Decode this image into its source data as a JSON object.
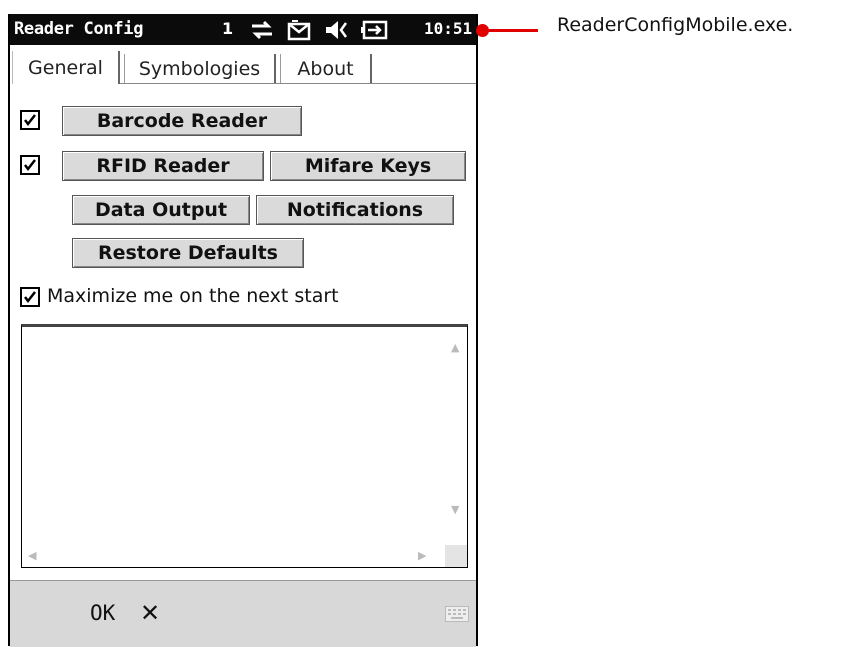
{
  "window": {
    "title": "Reader Config",
    "indicator": "1",
    "time": "10:51"
  },
  "tabs": [
    {
      "label": "General",
      "active": true
    },
    {
      "label": "Symbologies",
      "active": false
    },
    {
      "label": "About",
      "active": false
    }
  ],
  "general": {
    "barcode_checked": true,
    "barcode_button": "Barcode Reader",
    "rfid_checked": true,
    "rfid_button": "RFID Reader",
    "mifare_button": "Mifare Keys",
    "data_output_button": "Data Output",
    "notifications_button": "Notifications",
    "restore_button": "Restore Defaults",
    "maximize_checked": true,
    "maximize_label": "Maximize me on the next start",
    "log_text": ""
  },
  "softkeys": {
    "ok": "OK",
    "close": "✕"
  },
  "callout": {
    "text": "ReaderConfigMobile.exe.",
    "color": "#e00000"
  }
}
